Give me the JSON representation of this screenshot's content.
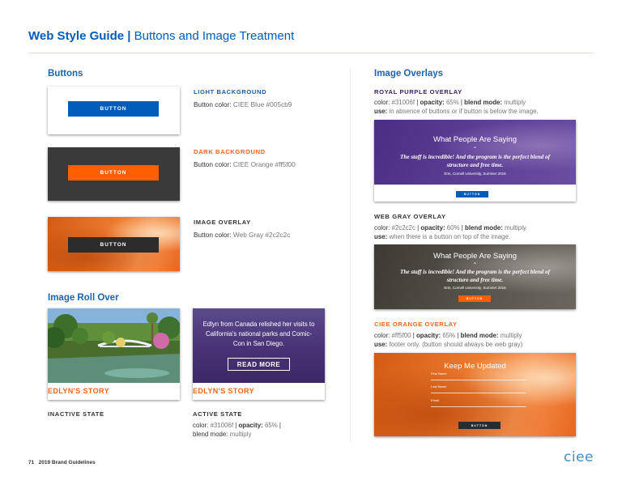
{
  "header": {
    "title_bold": "Web Style Guide |",
    "title_rest": "Buttons and Image Treatment"
  },
  "buttons": {
    "heading": "Buttons",
    "items": [
      {
        "demo_label": "BUTTON",
        "title": "LIGHT BACKGROUND",
        "desc_prefix": "Button color:",
        "desc_value": "CIEE Blue #005cb9",
        "color": "#005cb9"
      },
      {
        "demo_label": "BUTTON",
        "title": "DARK BACKGROUND",
        "desc_prefix": "Button color:",
        "desc_value": "CIEE Orange #ff5f00",
        "color": "#ff5f00"
      },
      {
        "demo_label": "BUTTON",
        "title": "IMAGE OVERLAY",
        "desc_prefix": "Button color:",
        "desc_value": "Web Gray #2c2c2c",
        "color": "#2c2c2c"
      }
    ]
  },
  "rollover": {
    "heading": "Image Roll Over",
    "inactive": {
      "story_label": "EDLYN'S STORY",
      "caption": "INACTIVE STATE"
    },
    "active": {
      "story_label": "EDLYN'S STORY",
      "overlay_text": "Edlyn from Canada relished her visits to California's national parks and Comic-Con in San Diego.",
      "button_label": "READ MORE",
      "caption": "ACTIVE STATE",
      "color_key": "color:",
      "color_val": "#31006f",
      "opacity_key": "opacity:",
      "opacity_val": "65%",
      "blend_key": "blend mode:",
      "blend_val": "multiply"
    }
  },
  "overlays": {
    "heading": "Image Overlays",
    "royal_purple": {
      "title": "ROYAL PURPLE OVERLAY",
      "color_key": "color:",
      "color_val": "#31006f",
      "opacity_key": "opacity:",
      "opacity_val": "65%",
      "blend_key": "blend mode:",
      "blend_val": "multiply",
      "use_key": "use:",
      "use_val": "in absence of buttons or if button is below the image.",
      "demo": {
        "heading": "What People Are Saying",
        "quote_mark": "“",
        "quote": "The staff is incredible! And the program is the perfect blend of structure and free time.",
        "attribution": "Erin, Cornell University, Summer 2016",
        "button": "BUTTON"
      }
    },
    "web_gray": {
      "title": "WEB GRAY OVERLAY",
      "color_key": "color:",
      "color_val": "#2c2c2c",
      "opacity_key": "opacity:",
      "opacity_val": "60%",
      "blend_key": "blend mode:",
      "blend_val": "multiply",
      "use_key": "use:",
      "use_val": "when there is a button on top of the image.",
      "demo": {
        "heading": "What People Are Saying",
        "quote_mark": "“",
        "quote": "The staff is incredible! And the program is the perfect blend of structure and free time.",
        "attribution": "Erin, Cornell University, Summer 2016",
        "button": "BUTTON"
      }
    },
    "ciee_orange": {
      "title": "CIEE ORANGE OVERLAY",
      "color_key": "color:",
      "color_val": "#ff5f00",
      "opacity_key": "opacity:",
      "opacity_val": "65%",
      "blend_key": "blend mode:",
      "blend_val": "multiply",
      "use_key": "use:",
      "use_val": "footer only. (button should always be web gray)",
      "demo": {
        "heading": "Keep Me Updated",
        "fields": [
          "First Name",
          "Last Name",
          "Email"
        ],
        "button": "BUTTON"
      }
    }
  },
  "footer": {
    "page_num": "71",
    "doc": "2019 Brand Guidelines",
    "logo": "ciee"
  }
}
